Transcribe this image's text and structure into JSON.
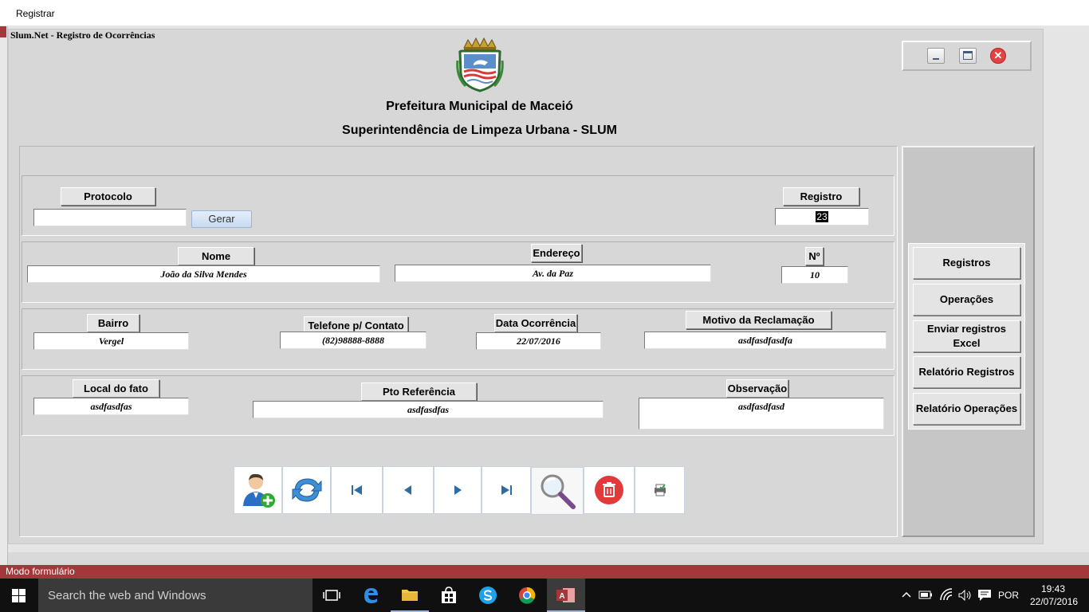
{
  "outer_window": {
    "title": "Registrar"
  },
  "form": {
    "caption": "Slum.Net - Registro de Ocorrências"
  },
  "header": {
    "org_line1": "Prefeitura Municipal de Maceió",
    "org_line2": "Superintendência de Limpeza Urbana - SLUM"
  },
  "fields": {
    "protocolo": {
      "label": "Protocolo",
      "value": ""
    },
    "gerar_label": "Gerar",
    "registro": {
      "label": "Registro",
      "value": "23"
    },
    "nome": {
      "label": "Nome",
      "value": "João da Silva Mendes"
    },
    "endereco": {
      "label": "Endereço",
      "value": "Av. da Paz"
    },
    "numero": {
      "label": "Nº",
      "value": "10"
    },
    "bairro": {
      "label": "Bairro",
      "value": "Vergel"
    },
    "telefone": {
      "label": "Telefone p/ Contato",
      "value": "(82)98888-8888"
    },
    "data_ocorrencia": {
      "label": "Data Ocorrência",
      "value": "22/07/2016"
    },
    "motivo": {
      "label": "Motivo da Reclamação",
      "value": "asdfasdfasdfa"
    },
    "local_fato": {
      "label": "Local do fato",
      "value": "asdfasdfas"
    },
    "pto_referencia": {
      "label": "Pto Referência",
      "value": "asdfasdfas"
    },
    "observacao": {
      "label": "Observação",
      "value": "asdfasdfasd"
    }
  },
  "side_menu": [
    {
      "label": "Registros"
    },
    {
      "label": "Operações"
    },
    {
      "label": "Enviar registros Excel"
    },
    {
      "label": "Relatório  Registros"
    },
    {
      "label": "Relatório Operações"
    }
  ],
  "toolbar_icons": [
    "add-user-icon",
    "refresh-icon",
    "first-record-icon",
    "previous-record-icon",
    "next-record-icon",
    "last-record-icon",
    "search-icon",
    "delete-icon",
    "print-icon"
  ],
  "status": {
    "text": "Modo formulário"
  },
  "taskbar": {
    "search_placeholder": "Search the web and Windows",
    "language": "POR",
    "time": "19:43",
    "date": "22/07/2016"
  },
  "colors": {
    "status_bar": "#a4373a",
    "form_background": "#d7d7d7",
    "taskbar": "#101010"
  }
}
